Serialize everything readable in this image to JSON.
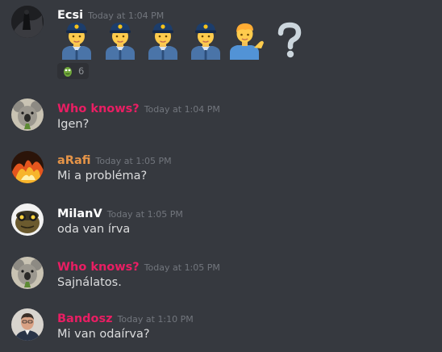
{
  "messages": [
    {
      "username": "Ecsi",
      "timestamp": "Today at 1:04 PM",
      "color": "#ffffff",
      "emoji": [
        "police-officer",
        "police-officer",
        "police-officer",
        "police-officer",
        "person-tipping-hand",
        "question-mark"
      ],
      "reaction": {
        "icon": "pickle-rick-emoji",
        "count": "6"
      }
    },
    {
      "username": "Who knows?",
      "timestamp": "Today at 1:04 PM",
      "color": "#e91e63",
      "text": "Igen?"
    },
    {
      "username": "aRafi",
      "timestamp": "Today at 1:05 PM",
      "color": "#e59448",
      "text": "Mi a probléma?"
    },
    {
      "username": "MilanV",
      "timestamp": "Today at 1:05 PM",
      "color": "#ffffff",
      "text": "oda van írva"
    },
    {
      "username": "Who knows?",
      "timestamp": "Today at 1:05 PM",
      "color": "#e91e63",
      "text": "Sajnálatos."
    },
    {
      "username": "Bandosz",
      "timestamp": "Today at 1:10 PM",
      "color": "#e91e63",
      "text": "Mi van odaírva?"
    }
  ]
}
